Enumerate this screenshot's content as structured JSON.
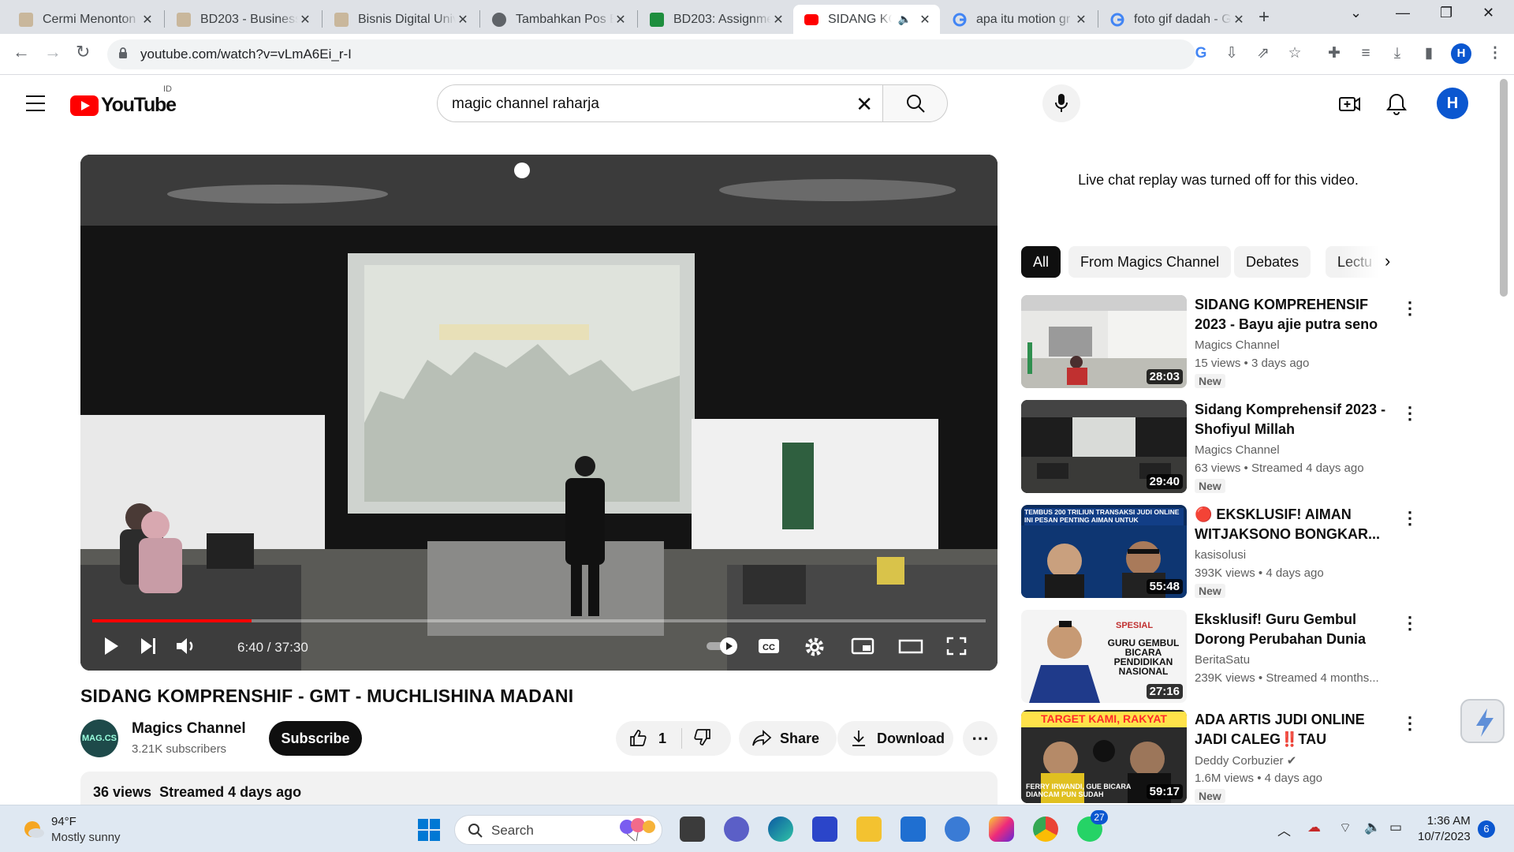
{
  "browser": {
    "tabs": [
      {
        "title": "Cermi Menonton",
        "icon": "ftvi-favicon"
      },
      {
        "title": "BD203 - Business",
        "icon": "ftvi-favicon"
      },
      {
        "title": "Bisnis Digital Univ",
        "icon": "ftvi-favicon"
      },
      {
        "title": "Tambahkan Pos B",
        "icon": "globe-icon"
      },
      {
        "title": "BD203: Assignme",
        "icon": "classroom-icon"
      },
      {
        "title": "SIDANG KOM",
        "icon": "youtube-icon"
      },
      {
        "title": "apa itu motion gr",
        "icon": "google-icon"
      },
      {
        "title": "foto gif dadah - G",
        "icon": "google-icon"
      }
    ],
    "url": "youtube.com/watch?v=vLmA6Ei_r-I",
    "profile_initial": "H"
  },
  "youtube": {
    "logo_text": "YouTube",
    "country_code": "ID",
    "search_query": "magic channel raharja",
    "avatar_initial": "H"
  },
  "player": {
    "time": "6:40 / 37:30",
    "progress": 0.178
  },
  "video": {
    "title": "SIDANG KOMPRENSHIF - GMT - MUCHLISHINA MADANI",
    "channel": "Magics Channel",
    "channel_avatar_text": "MAG.CS",
    "subscribers": "3.21K subscribers",
    "subscribe_label": "Subscribe",
    "likes": "1",
    "share_label": "Share",
    "download_label": "Download",
    "views": "36 views",
    "streamed": "Streamed 4 days ago"
  },
  "sidebar": {
    "chat_note": "Live chat replay was turned off for this video.",
    "chips": [
      "All",
      "From Magics Channel",
      "Debates",
      "Lectu"
    ],
    "recommendations": [
      {
        "title": "SIDANG KOMPREHENSIF 2023 - Bayu ajie putra seno",
        "channel": "Magics Channel",
        "views": "15 views",
        "age": "3 days ago",
        "duration": "28:03",
        "badge": "New"
      },
      {
        "title": "Sidang Komprehensif 2023 - Shofiyul Millah",
        "channel": "Magics Channel",
        "views": "63 views",
        "age": "Streamed 4 days ago",
        "duration": "29:40",
        "badge": "New"
      },
      {
        "title": "🔴 EKSKLUSIF! AIMAN WITJAKSONO BONGKAR...",
        "channel": "kasisolusi",
        "views": "393K views",
        "age": "4 days ago",
        "duration": "55:48",
        "badge": "New"
      },
      {
        "title": "Eksklusif! Guru Gembul Dorong Perubahan Dunia Pendidikan |...",
        "channel": "BeritaSatu",
        "views": "239K views",
        "age": "Streamed 4 months...",
        "duration": "27:16",
        "badge": ""
      },
      {
        "title": "ADA ARTIS JUDI ONLINE JADI CALEG‼️TAU KALIAN⁉️ FAKTA...",
        "channel": "Deddy Corbuzier ✔",
        "views": "1.6M views",
        "age": "4 days ago",
        "duration": "59:17",
        "badge": "New"
      }
    ],
    "thumb_texts": {
      "t3_top": "TEMBUS 200 TRILIUN TRANSAKSI JUDI ONLINE INI PESAN PENTING AIMAN UNTUK PEMERINTAH",
      "t4_top": "SPESIAL",
      "t4_mid": "GURU GEMBUL BICARA PENDIDIKAN NASIONAL",
      "t5_top": "TARGET KAMI, RAKYAT MISKIN",
      "t5_bottom": "FERRY IRWANDI, GUE BICARA DIANCAM PUN SUDAH"
    }
  },
  "taskbar": {
    "temperature": "94°F",
    "weather": "Mostly sunny",
    "search_label": "Search",
    "whatsapp_badge": "27",
    "time": "1:36 AM",
    "date": "10/7/2023",
    "notifications": "6"
  },
  "colors": {
    "youtube_red": "#ff0000",
    "accent_blue": "#0b57d0",
    "chip_active": "#0f0f0f"
  }
}
